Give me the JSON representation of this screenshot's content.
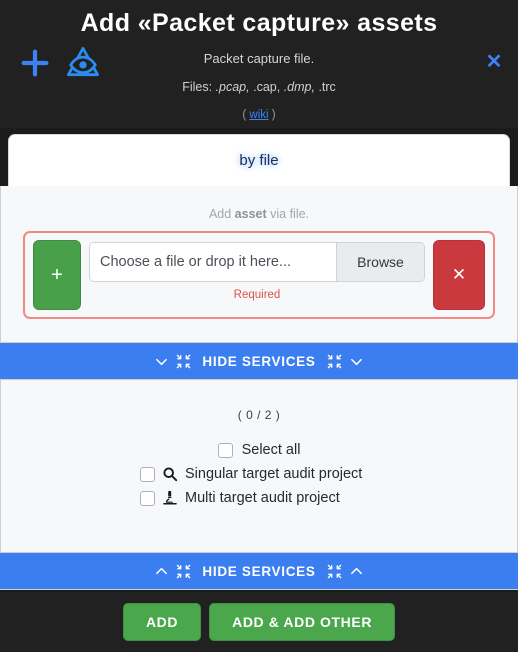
{
  "header": {
    "title": "Add «Packet capture» assets",
    "subtitle": "Packet capture file.",
    "files_prefix": "Files:",
    "files_pcap": ".pcap,",
    "files_cap": ".cap,",
    "files_dmp": ".dmp,",
    "files_trc": ".trc",
    "wiki_open": "(",
    "wiki_label": "wiki",
    "wiki_close": ")",
    "close_label": "✕",
    "plus_icon": "plus-icon",
    "eye_triangle_icon": "eye-in-triangle-icon"
  },
  "tabs": [
    {
      "label": "by file",
      "active": true
    }
  ],
  "body": {
    "hint_prefix": "Add ",
    "hint_bold": "asset",
    "hint_suffix": " via file.",
    "add_row_button": "+",
    "file_input_placeholder": "Choose a file or drop it here...",
    "file_input_value": "",
    "browse_label": "Browse",
    "required_label": "Required",
    "remove_row_button": "✕"
  },
  "services_bar_top": {
    "label": "HIDE SERVICES",
    "left_chevron": "chevron-down-icon",
    "left_compress": "compress-arrows-icon",
    "right_compress": "compress-arrows-icon",
    "right_chevron": "chevron-down-icon"
  },
  "services_bar_bottom": {
    "label": "HIDE SERVICES",
    "left_chevron": "chevron-up-icon",
    "left_compress": "compress-arrows-icon",
    "right_compress": "compress-arrows-icon",
    "right_chevron": "chevron-up-icon"
  },
  "services": {
    "counter": "( 0 / 2 )",
    "select_all_label": "Select all",
    "select_all_checked": false,
    "items": [
      {
        "label": "Singular target audit project",
        "icon": "magnifier-icon",
        "checked": false
      },
      {
        "label": "Multi target audit project",
        "icon": "microscope-icon",
        "checked": false
      }
    ]
  },
  "footer": {
    "add_label": "ADD",
    "add_other_label": "ADD & ADD OTHER"
  },
  "colors": {
    "page_background": "#212121",
    "panel_background": "#1c1c1c",
    "body_background": "#f7f8fa",
    "accent_blue": "#3b7ef0",
    "link_blue": "#3b82f6",
    "green": "#4aa74c",
    "red": "#c9393e",
    "error_border": "#f08a82",
    "error_text": "#d9534f"
  }
}
